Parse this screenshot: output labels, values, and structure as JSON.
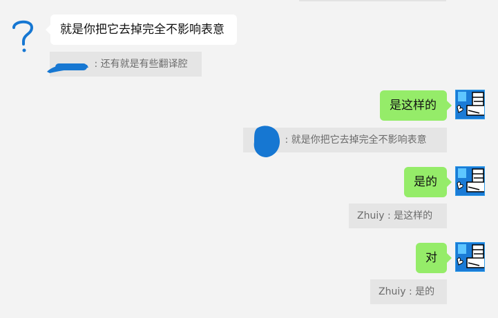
{
  "messages": [
    {
      "side": "left",
      "text": "就是你把它去掉完全不影响表意"
    },
    {
      "side": "left-quote",
      "sender": "",
      "text": "还有就是有些翻译腔"
    },
    {
      "side": "right",
      "text": "是这样的"
    },
    {
      "side": "right-quote",
      "sender": "",
      "text": "就是你把它去掉完全不影响表意"
    },
    {
      "side": "right",
      "text": "是的"
    },
    {
      "side": "right-quote",
      "sender": "Zhuiy",
      "text": "是这样的"
    },
    {
      "side": "right",
      "text": "对"
    },
    {
      "side": "right-quote",
      "sender": "Zhuiy",
      "text": "是的"
    }
  ],
  "separator": " : ",
  "colors": {
    "background": "#f3f3f3",
    "bubble_self": "#95ec69",
    "bubble_other": "#ffffff",
    "quote_bg": "#e5e5e5",
    "scribble": "#1677d2"
  },
  "icons": {
    "left_avatar": "question-mark-icon",
    "right_avatar": "cartoon-face-avatar"
  }
}
